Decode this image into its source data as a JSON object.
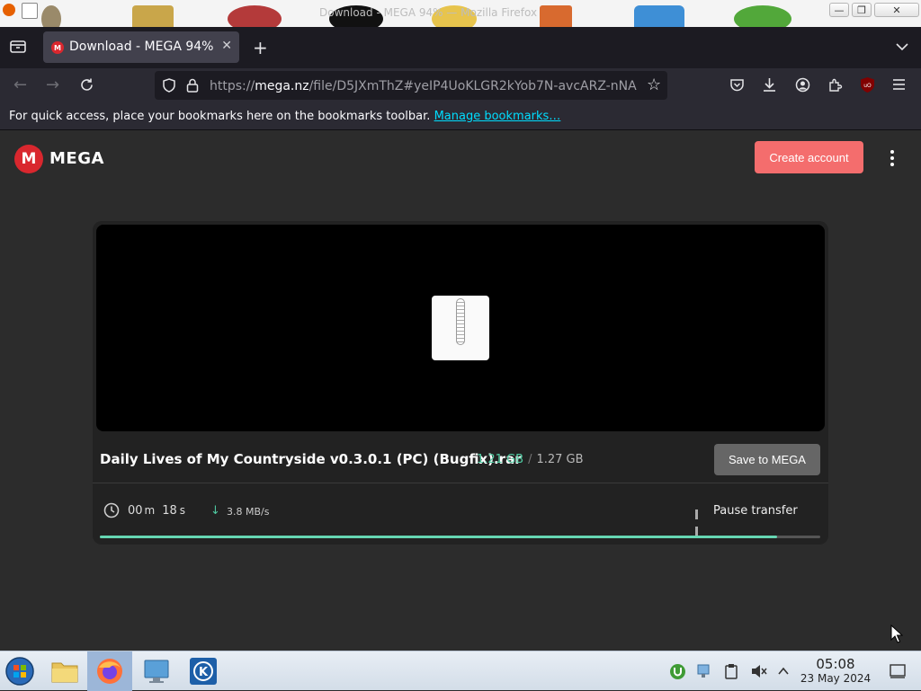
{
  "window": {
    "title": "Download - MEGA 94% — Mozilla Firefox",
    "minimize_icon": "minimize-icon",
    "maximize_icon": "maximize-icon",
    "close_icon": "close-icon"
  },
  "tabs": [
    {
      "label": "Download - MEGA 94%",
      "favicon": "mega-icon",
      "active": true
    }
  ],
  "toolbar": {
    "url_scheme": "https://",
    "url_host": "mega.nz",
    "url_path": "/file/D5JXmThZ#yeIP4UoKLGR2kYob7N-avcARZ-nNA"
  },
  "bookmarks_bar": {
    "message": "For quick access, place your bookmarks here on the bookmarks toolbar.",
    "link": "Manage bookmarks…"
  },
  "mega": {
    "logo_letter": "M",
    "brand": "MEGA",
    "create_account": "Create account",
    "file_name": "Daily Lives of My Countryside v0.3.0.1 (PC) (Bugfix).rar",
    "downloaded": "1.21 GB",
    "separator": "/",
    "total": "1.27 GB",
    "save_label": "Save to MEGA",
    "time_minutes": "00",
    "time_minutes_unit": "m",
    "time_seconds": "18",
    "time_seconds_unit": "s",
    "speed": "3.8 MB/s",
    "pause_label": "Pause transfer",
    "progress_percent": 94
  },
  "taskbar": {
    "time": "05:08",
    "date": "23 May 2024"
  },
  "colors": {
    "mega_red": "#d9272e",
    "create_button": "#f46d6d",
    "progress": "#66d6b3",
    "link": "#00ddff"
  }
}
